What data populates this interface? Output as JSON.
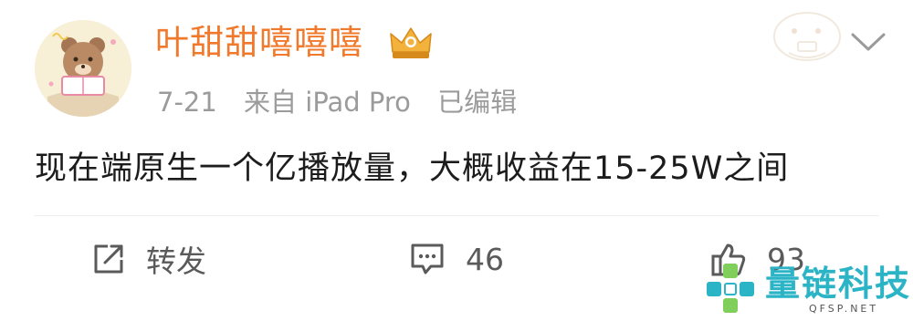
{
  "post": {
    "username": "叶甜甜嘻嘻嘻",
    "date": "7-21",
    "source": "来自 iPad Pro",
    "edited": "已编辑",
    "content": "现在端原生一个亿播放量，大概收益在15-25W之间"
  },
  "actions": {
    "repost_label": "转发",
    "comment_count": "46",
    "like_count": "93"
  },
  "watermark": {
    "name": "量链科技",
    "domain": "QFSP.NET"
  },
  "colors": {
    "username": "#f0792b",
    "meta": "#9b9b9b",
    "content": "#1c1c1c",
    "action": "#5a5a5a",
    "watermark": "#2bb3c6"
  },
  "icons": {
    "avatar": "bear-avatar",
    "badge": "crown-icon",
    "menu": "chevron-down-icon",
    "repost": "repost-icon",
    "comment": "comment-icon",
    "like": "thumbs-up-icon"
  }
}
